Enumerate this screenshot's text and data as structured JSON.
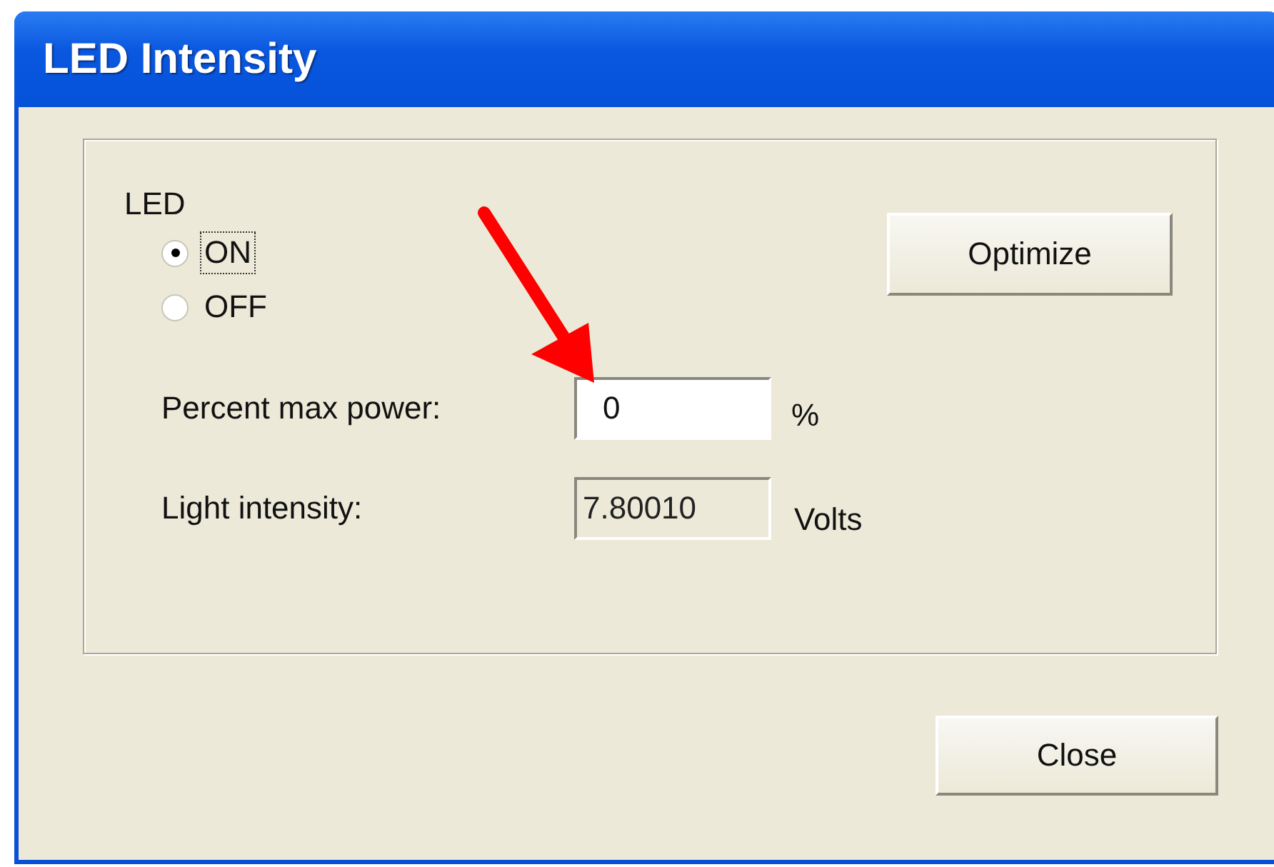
{
  "window": {
    "title": "LED Intensity"
  },
  "led_group": {
    "label": "LED",
    "options": [
      {
        "label": "ON",
        "selected": true
      },
      {
        "label": "OFF",
        "selected": false
      }
    ]
  },
  "optimize_button": "Optimize",
  "fields": [
    {
      "label": "Percent max power:",
      "value": "0",
      "unit": "%",
      "kind": "input"
    },
    {
      "label": "Light intensity:",
      "value": "7.80010",
      "unit": "Volts",
      "kind": "readonly"
    }
  ],
  "buttons": [
    "Close"
  ]
}
